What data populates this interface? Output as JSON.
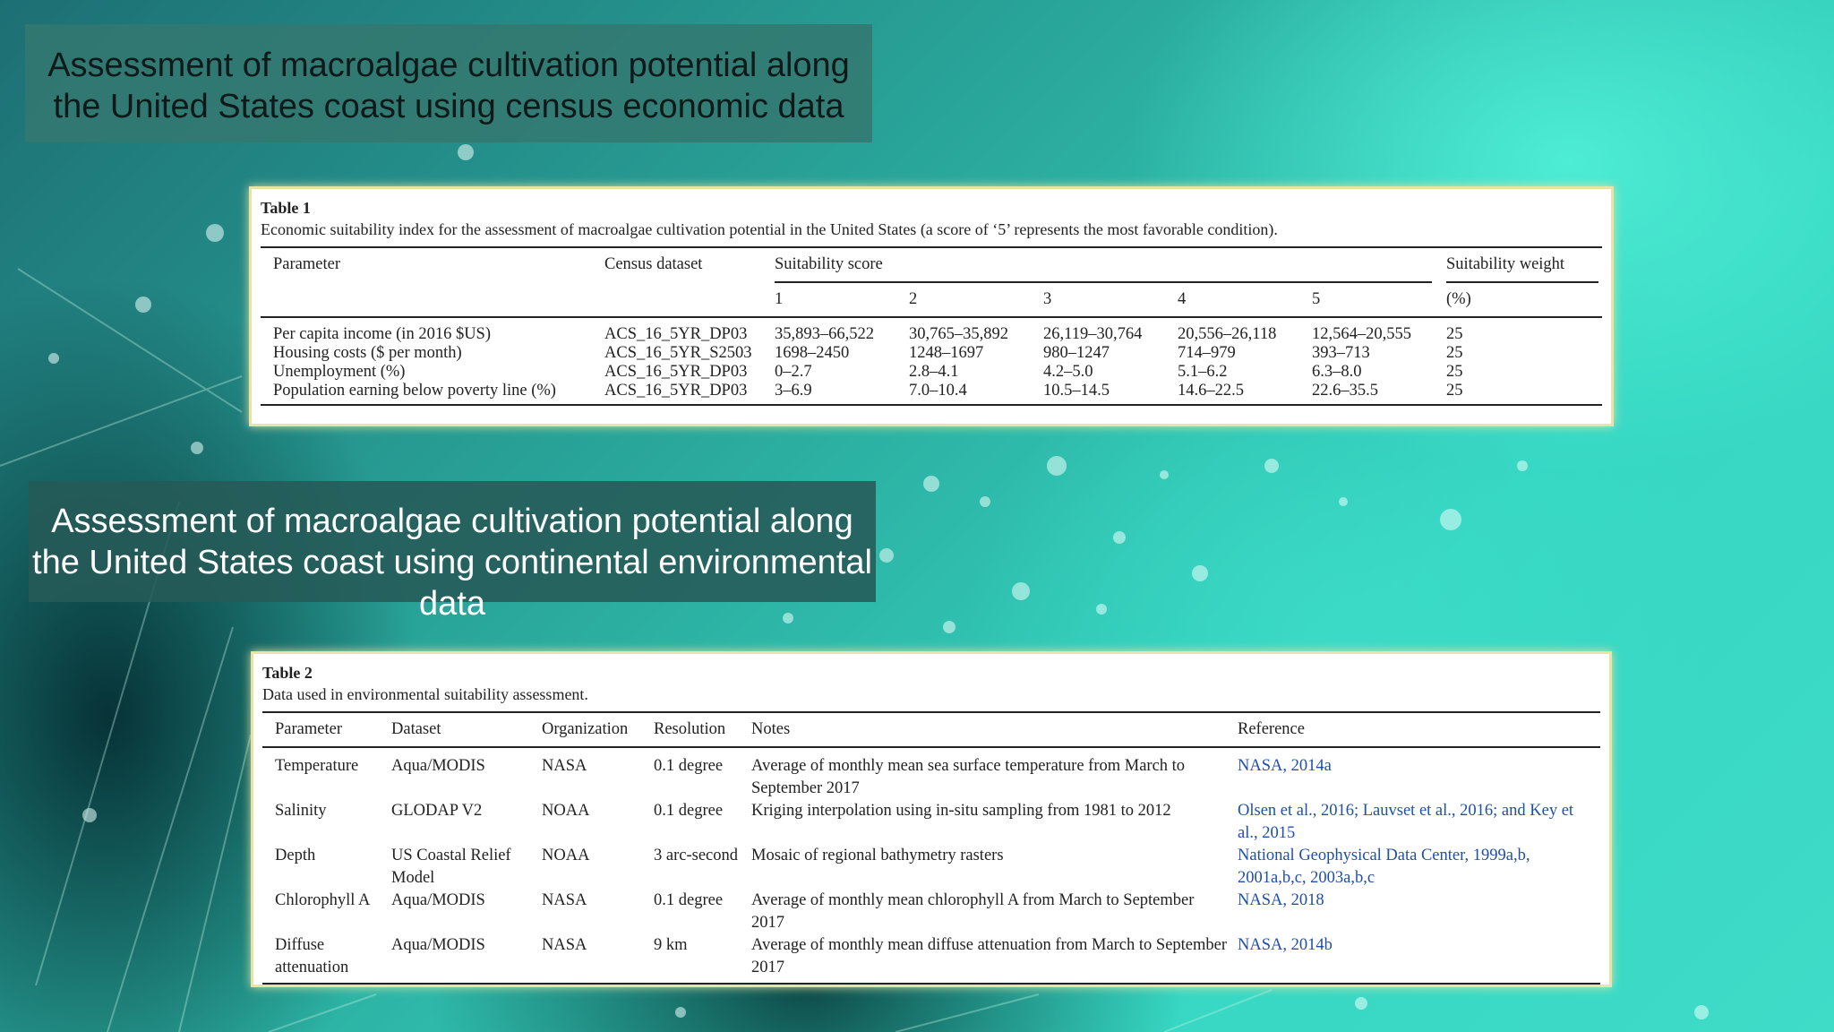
{
  "slide": {
    "heading_1": "Assessment of macroalgae cultivation potential along the United States coast using census economic data",
    "heading_2": "Assessment of macroalgae cultivation potential along the United States coast using continental environmental data"
  },
  "table1": {
    "label": "Table 1",
    "caption": "Economic suitability index for the assessment of macroalgae cultivation potential in the United States (a score of ‘5’ represents the most favorable condition).",
    "head": {
      "parameter": "Parameter",
      "census": "Census dataset",
      "score": "Suitability score",
      "weight": "Suitability weight",
      "weight_unit": "(%)",
      "scores": [
        "1",
        "2",
        "3",
        "4",
        "5"
      ]
    },
    "rows": [
      {
        "parameter": "Per capita income (in 2016 $US)",
        "census": "ACS_16_5YR_DP03",
        "s1": "35,893–66,522",
        "s2": "30,765–35,892",
        "s3": "26,119–30,764",
        "s4": "20,556–26,118",
        "s5": "12,564–20,555",
        "weight": "25"
      },
      {
        "parameter": "Housing costs ($ per month)",
        "census": "ACS_16_5YR_S2503",
        "s1": "1698–2450",
        "s2": "1248–1697",
        "s3": "980–1247",
        "s4": "714–979",
        "s5": "393–713",
        "weight": "25"
      },
      {
        "parameter": "Unemployment (%)",
        "census": "ACS_16_5YR_DP03",
        "s1": "0–2.7",
        "s2": "2.8–4.1",
        "s3": "4.2–5.0",
        "s4": "5.1–6.2",
        "s5": "6.3–8.0",
        "weight": "25"
      },
      {
        "parameter": "Population earning below poverty line (%)",
        "census": "ACS_16_5YR_DP03",
        "s1": "3–6.9",
        "s2": "7.0–10.4",
        "s3": "10.5–14.5",
        "s4": "14.6–22.5",
        "s5": "22.6–35.5",
        "weight": "25"
      }
    ]
  },
  "table2": {
    "label": "Table 2",
    "caption": "Data used in environmental suitability assessment.",
    "head": {
      "parameter": "Parameter",
      "dataset": "Dataset",
      "organization": "Organization",
      "resolution": "Resolution",
      "notes": "Notes",
      "reference": "Reference"
    },
    "rows": [
      {
        "parameter": "Temperature",
        "dataset": "Aqua/MODIS",
        "organization": "NASA",
        "resolution": "0.1 degree",
        "notes": "Average of monthly mean sea surface temperature from March to September 2017",
        "reference": "NASA, 2014a"
      },
      {
        "parameter": "Salinity",
        "dataset": "GLODAP V2",
        "organization": "NOAA",
        "resolution": "0.1 degree",
        "notes": "Kriging interpolation using in-situ sampling from 1981 to 2012",
        "reference": "Olsen et al., 2016; Lauvset et al., 2016; and Key et al., 2015"
      },
      {
        "parameter": "Depth",
        "dataset": "US Coastal Relief Model",
        "organization": "NOAA",
        "resolution": "3 arc-second",
        "notes": "Mosaic of regional bathymetry rasters",
        "reference": "National Geophysical Data Center, 1999a,b, 2001a,b,c, 2003a,b,c"
      },
      {
        "parameter": "Chlorophyll A",
        "dataset": "Aqua/MODIS",
        "organization": "NASA",
        "resolution": "0.1 degree",
        "notes": "Average of monthly mean chlorophyll A from March to September 2017",
        "reference": "NASA, 2018"
      },
      {
        "parameter": "Diffuse attenuation",
        "dataset": "Aqua/MODIS",
        "organization": "NASA",
        "resolution": "9 km",
        "notes": "Average of monthly mean diffuse attenuation from March to September 2017",
        "reference": "NASA, 2014b"
      }
    ]
  }
}
